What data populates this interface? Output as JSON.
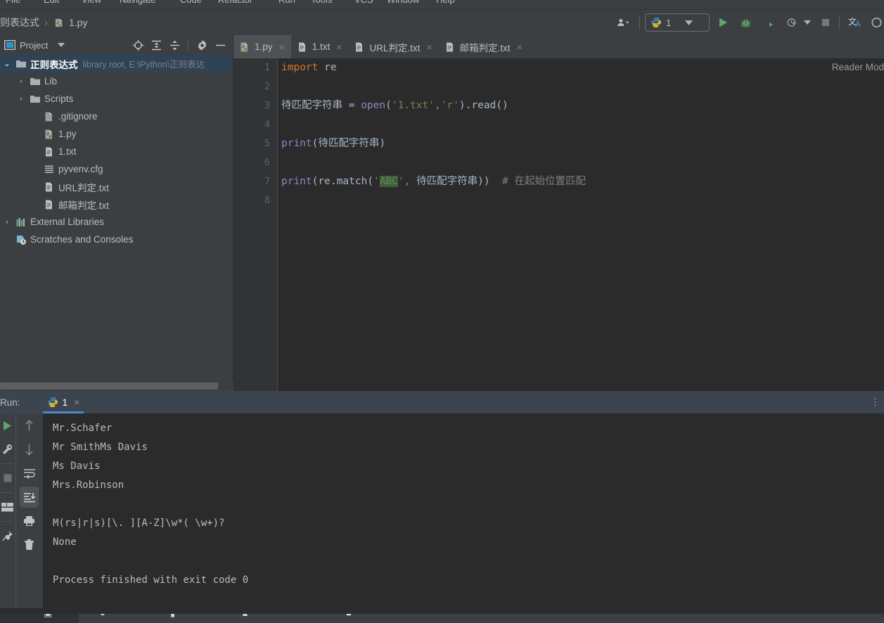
{
  "window": {
    "theme": "darcula",
    "accent": "#4a88c7",
    "bg_panel": "#3c3f41",
    "bg_editor": "#2b2b2b",
    "bg_gutter": "#313335"
  },
  "menubar": {
    "items": [
      "File",
      "Edit",
      "View",
      "Navigate",
      "Code",
      "Refactor",
      "Run",
      "Tools",
      "VCS",
      "Window",
      "Help"
    ]
  },
  "navbar": {
    "breadcrumb_project": "则表达式",
    "breadcrumb_separator": "›",
    "breadcrumb_file": "1.py",
    "run_config_name": "1",
    "icons": {
      "user": "user-dropdown-icon",
      "run": "run-icon",
      "debug": "debug-icon",
      "coverage": "run-with-coverage-icon",
      "profile": "profile-icon",
      "stop": "stop-icon",
      "translate": "translate-icon",
      "search": "search-icon"
    }
  },
  "project_panel": {
    "title": "Project",
    "toolbar_icons": [
      "locate-icon",
      "expand-all-icon",
      "collapse-all-icon",
      "settings-gear-icon",
      "hide-icon"
    ],
    "tree": [
      {
        "label": "正则表达式",
        "sub": "library root,  E:\\Python\\正则表达",
        "icon": "folder-icon",
        "arrow": "⌄",
        "depth": 0,
        "selected": true,
        "bold": true
      },
      {
        "label": "Lib",
        "sub": "",
        "icon": "folder-icon",
        "arrow": "›",
        "depth": 1,
        "selected": false,
        "bold": false
      },
      {
        "label": "Scripts",
        "sub": "",
        "icon": "folder-icon",
        "arrow": "›",
        "depth": 1,
        "selected": false,
        "bold": false
      },
      {
        "label": ".gitignore",
        "sub": "",
        "icon": "gitignore-file-icon",
        "arrow": "",
        "depth": 2,
        "selected": false,
        "bold": false
      },
      {
        "label": "1.py",
        "sub": "",
        "icon": "python-file-icon",
        "arrow": "",
        "depth": 2,
        "selected": false,
        "bold": false
      },
      {
        "label": "1.txt",
        "sub": "",
        "icon": "text-file-icon",
        "arrow": "",
        "depth": 2,
        "selected": false,
        "bold": false
      },
      {
        "label": "pyvenv.cfg",
        "sub": "",
        "icon": "config-file-icon",
        "arrow": "",
        "depth": 2,
        "selected": false,
        "bold": false
      },
      {
        "label": "URL判定.txt",
        "sub": "",
        "icon": "text-file-icon",
        "arrow": "",
        "depth": 2,
        "selected": false,
        "bold": false
      },
      {
        "label": "邮箱判定.txt",
        "sub": "",
        "icon": "text-file-icon",
        "arrow": "",
        "depth": 2,
        "selected": false,
        "bold": false
      },
      {
        "label": "External Libraries",
        "sub": "",
        "icon": "libraries-icon",
        "arrow": "›",
        "depth": 0,
        "selected": false,
        "bold": false
      },
      {
        "label": "Scratches and Consoles",
        "sub": "",
        "icon": "scratches-icon",
        "arrow": "",
        "depth": 0,
        "selected": false,
        "bold": false
      }
    ]
  },
  "editor": {
    "tabs": [
      {
        "label": "1.py",
        "icon": "python-file-icon",
        "active": true,
        "close": "×"
      },
      {
        "label": "1.txt",
        "icon": "text-file-icon",
        "active": false,
        "close": "×"
      },
      {
        "label": "URL判定.txt",
        "icon": "text-file-icon",
        "active": false,
        "close": "×"
      },
      {
        "label": "邮箱判定.txt",
        "icon": "text-file-icon",
        "active": false,
        "close": "×"
      }
    ],
    "reader_mode_label": "Reader Mod",
    "line_numbers": [
      "1",
      "2",
      "3",
      "4",
      "5",
      "6",
      "7",
      "8"
    ],
    "code_lines": [
      [
        {
          "t": "import",
          "c": "k-kw"
        },
        {
          "t": " re",
          "c": "k-def"
        }
      ],
      [],
      [
        {
          "t": "待匹配字符串 ",
          "c": "k-def"
        },
        {
          "t": "= ",
          "c": "k-def"
        },
        {
          "t": "open",
          "c": "k-fn"
        },
        {
          "t": "(",
          "c": "k-def"
        },
        {
          "t": "'1.txt'",
          "c": "k-str"
        },
        {
          "t": ",",
          "c": "k-comma"
        },
        {
          "t": "'r'",
          "c": "k-str"
        },
        {
          "t": ").read()",
          "c": "k-def"
        }
      ],
      [],
      [
        {
          "t": "print",
          "c": "k-fn"
        },
        {
          "t": "(待匹配字符串)",
          "c": "k-def"
        }
      ],
      [],
      [
        {
          "t": "print",
          "c": "k-fn"
        },
        {
          "t": "(re.match(",
          "c": "k-def"
        },
        {
          "t": "'",
          "c": "k-str"
        },
        {
          "t": "ABC",
          "c": "k-sel"
        },
        {
          "t": "'",
          "c": "k-str"
        },
        {
          "t": ",",
          "c": "k-comma"
        },
        {
          "t": " 待匹配字符串))",
          "c": "k-def"
        },
        {
          "t": "  # 在起始位置匹配",
          "c": "k-cmt"
        }
      ],
      []
    ]
  },
  "run_window": {
    "run_label": "Run:",
    "tab_label": "1",
    "tab_icon": "python-icon",
    "tab_close": "×",
    "side_icons_left": [
      "rerun-icon",
      "wrench-settings-icon",
      "stop-icon",
      "layout-icon",
      "pin-icon"
    ],
    "side_icons_right": [
      "up-arrow-icon",
      "down-arrow-icon",
      "soft-wrap-icon",
      "scroll-to-end-icon",
      "print-icon",
      "trash-icon"
    ],
    "console_output": [
      "Mr.Schafer",
      "Mr SmithMs Davis",
      "Ms Davis",
      "Mrs.Robinson",
      "",
      "M(rs|r|s)[\\. ][A-Z]\\w*( \\w+)?",
      "None",
      "",
      "Process finished with exit code 0"
    ]
  }
}
